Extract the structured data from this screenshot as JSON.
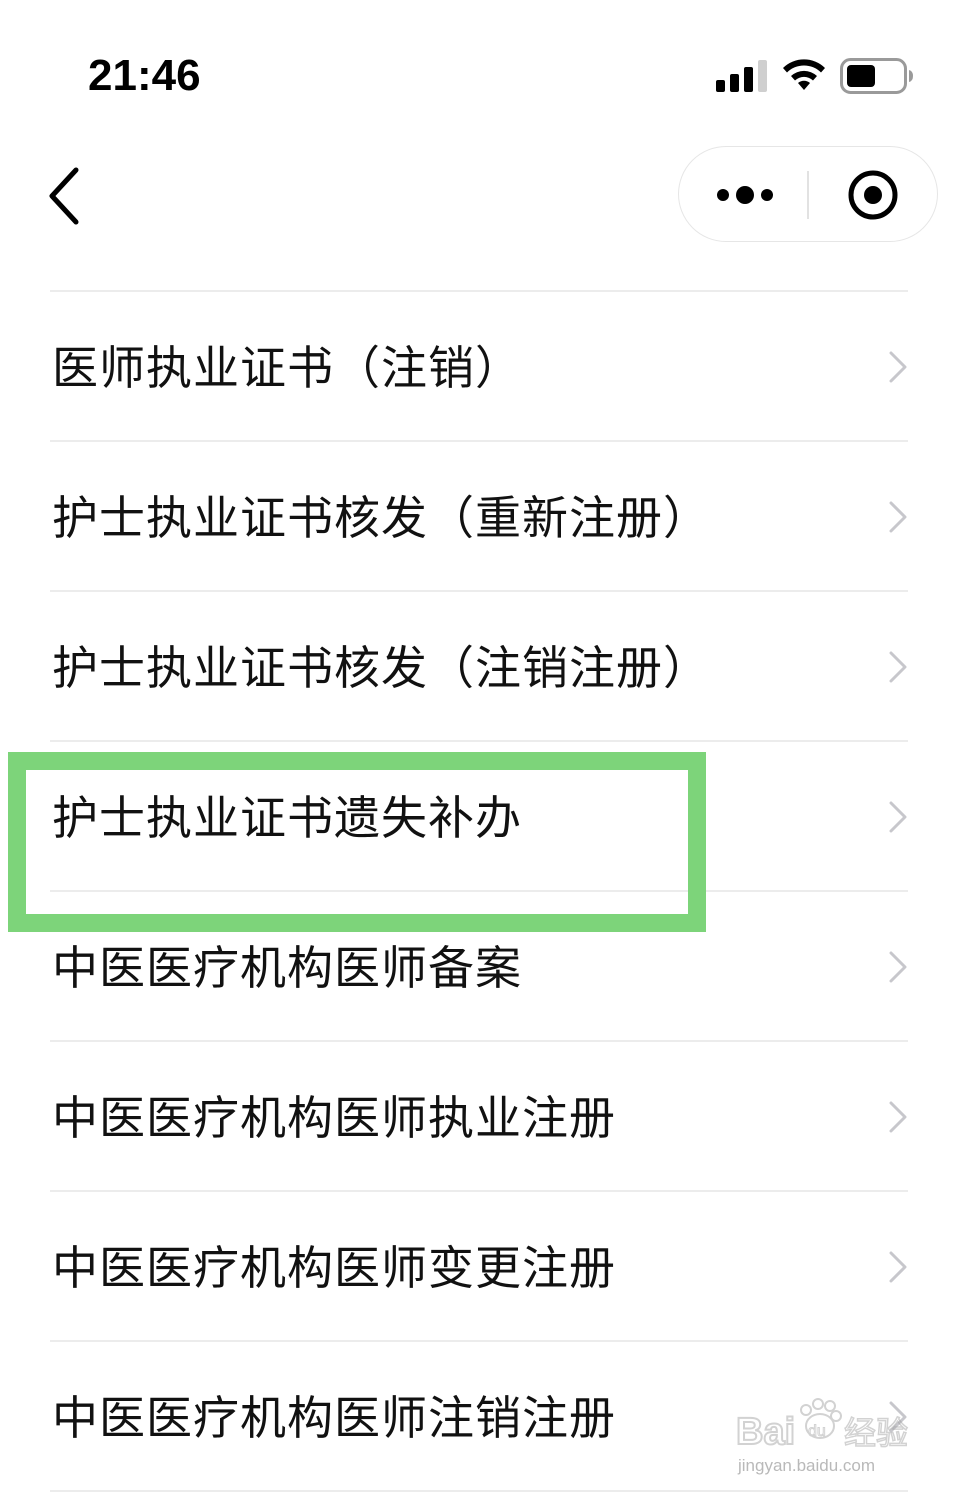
{
  "status_bar": {
    "time": "21:46"
  },
  "nav": {
    "back_icon": "chevron-left-icon",
    "more_icon": "more-dots-icon",
    "close_icon": "target-close-icon"
  },
  "list": {
    "items": [
      {
        "label": "医师执业证书（注销）"
      },
      {
        "label": "护士执业证书核发（重新注册）"
      },
      {
        "label": "护士执业证书核发（注销注册）"
      },
      {
        "label": "护士执业证书遗失补办"
      },
      {
        "label": "中医医疗机构医师备案"
      },
      {
        "label": "中医医疗机构医师执业注册"
      },
      {
        "label": "中医医疗机构医师变更注册"
      },
      {
        "label": "中医医疗机构医师注销注册"
      }
    ],
    "highlighted_index": 3
  },
  "colors": {
    "highlight": "#7dd47a",
    "divider": "#ececec",
    "chevron": "#c7c7cc"
  },
  "watermark": {
    "brand": "Bai du 经验",
    "url": "jingyan.baidu.com"
  }
}
